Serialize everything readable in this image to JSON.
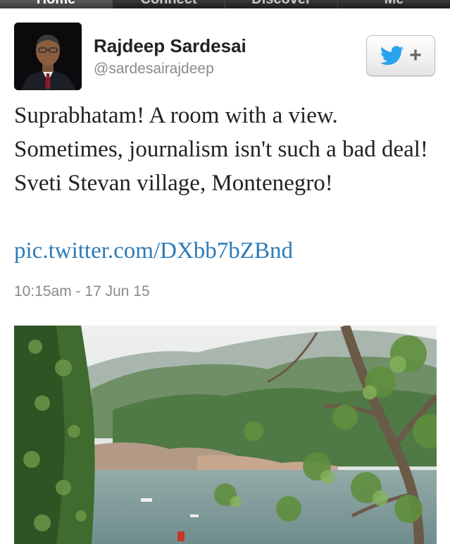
{
  "tabbar": {
    "tabs": [
      {
        "label": "Home",
        "active": true
      },
      {
        "label": "Connect",
        "active": false
      },
      {
        "label": "Discover",
        "active": false
      },
      {
        "label": "Me",
        "active": false
      }
    ]
  },
  "tweet": {
    "author_name": "Rajdeep Sardesai",
    "author_handle": "@sardesairajdeep",
    "text": "Suprabhatam! A room with a view. Sometimes, journalism isn't such a bad deal! Sveti Stevan village, Montenegro!",
    "link_text": "pic.twitter.com/DXbb7bZBnd",
    "timestamp": "10:15am - 17 Jun 15",
    "follow_button": {
      "icon": "twitter-bird-icon",
      "label": "+"
    }
  },
  "colors": {
    "link": "#2b7bb9",
    "twitter_blue": "#2aa3ef",
    "meta_gray": "#8a8a8a"
  }
}
